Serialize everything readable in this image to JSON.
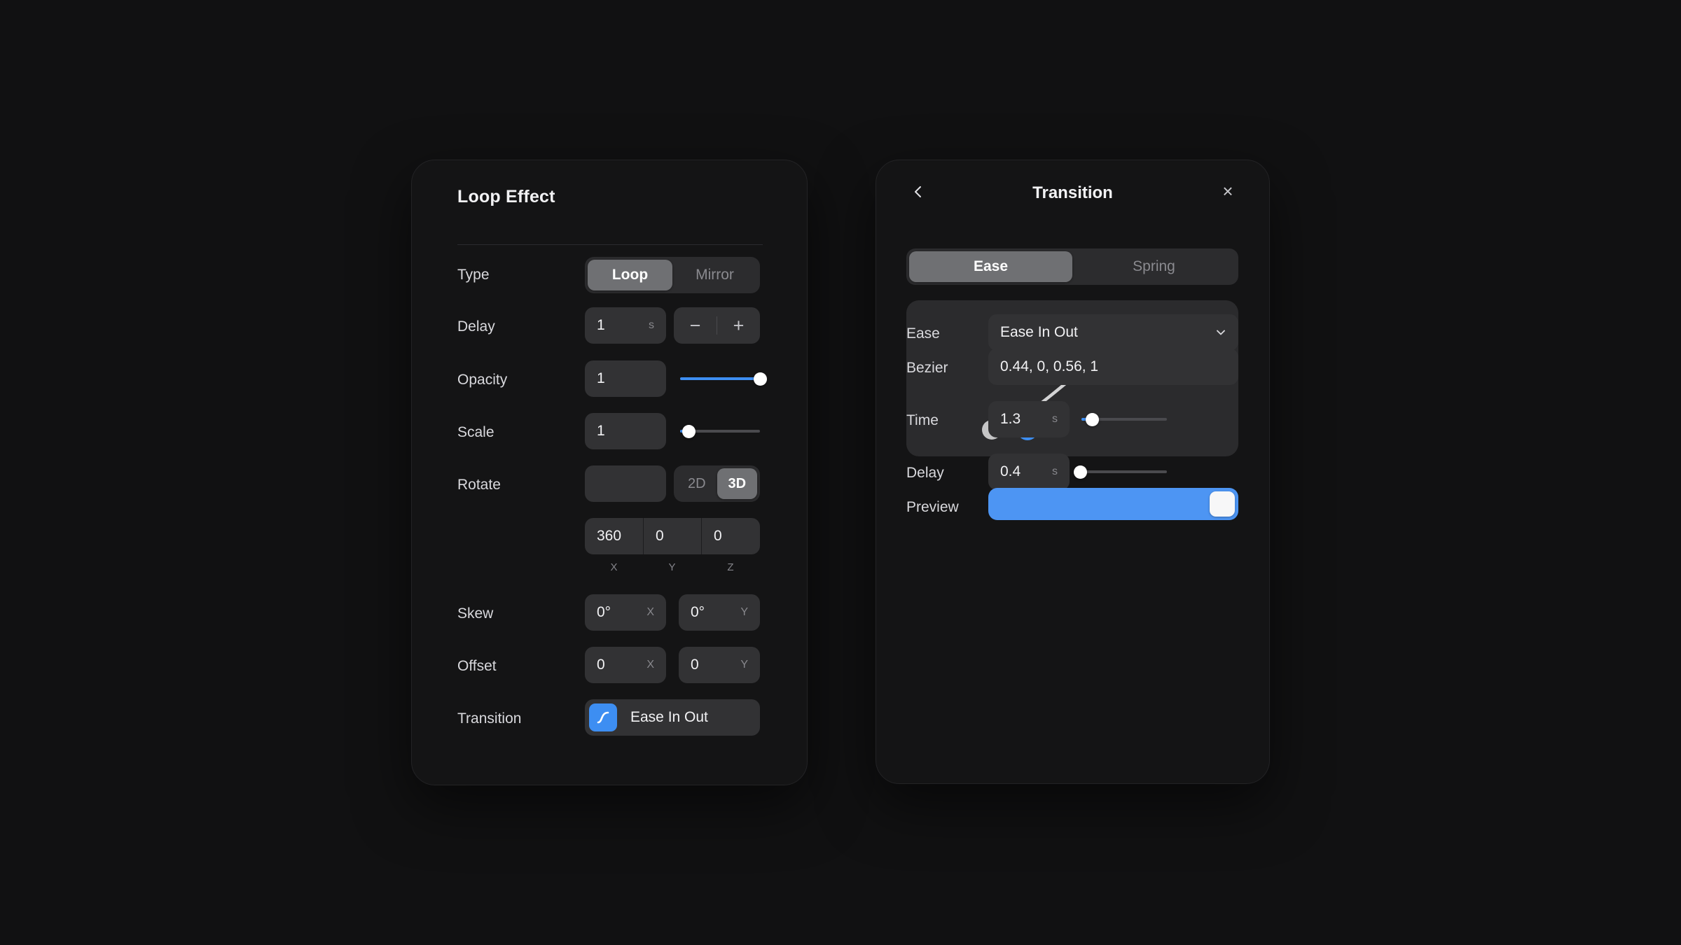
{
  "theme": {
    "background": "#111112",
    "panel_bg": "#141415",
    "field_bg": "#323234",
    "accent": "#3d8ef2",
    "toggle_on": "#4d95f3",
    "segment_active": "#6f7073",
    "text_primary": "#f2f2f4",
    "text_muted": "#88888d"
  },
  "loop_panel": {
    "title": "Loop Effect",
    "close_label": "×",
    "rows": {
      "type": {
        "label": "Type",
        "options": [
          "Loop",
          "Mirror"
        ],
        "selected": "Loop"
      },
      "delay": {
        "label": "Delay",
        "value": "1",
        "unit": "s",
        "minus_label": "−",
        "plus_label": "+"
      },
      "opacity": {
        "label": "Opacity",
        "value": "1",
        "slider_percent": 100
      },
      "scale": {
        "label": "Scale",
        "value": "1",
        "slider_percent": 11
      },
      "rotate": {
        "label": "Rotate",
        "value": "",
        "modes": [
          "2D",
          "3D"
        ],
        "selected_mode": "3D",
        "axes": [
          {
            "axis": "X",
            "value": "360"
          },
          {
            "axis": "Y",
            "value": "0"
          },
          {
            "axis": "Z",
            "value": "0"
          }
        ]
      },
      "skew": {
        "label": "Skew",
        "fields": [
          {
            "value": "0°",
            "suffix": "X"
          },
          {
            "value": "0°",
            "suffix": "Y"
          }
        ]
      },
      "offset": {
        "label": "Offset",
        "fields": [
          {
            "value": "0",
            "suffix": "X"
          },
          {
            "value": "0",
            "suffix": "Y"
          }
        ]
      },
      "transition": {
        "label": "Transition",
        "value": "Ease In Out",
        "icon": "ease-curve-icon"
      }
    }
  },
  "transition_panel": {
    "title": "Transition",
    "back_label": "‹",
    "close_label": "×",
    "tabs": {
      "options": [
        "Ease",
        "Spring"
      ],
      "selected": "Ease"
    },
    "bezier_editor": {
      "control_points": [
        0.44,
        0,
        0.56,
        1
      ],
      "start_point": [
        0,
        0
      ],
      "end_point": [
        1,
        1
      ]
    },
    "rows": {
      "ease": {
        "label": "Ease",
        "value": "Ease In Out",
        "caret": "chevron-down-icon"
      },
      "bezier": {
        "label": "Bezier",
        "value": "0.44, 0, 0.56, 1"
      },
      "time": {
        "label": "Time",
        "value": "1.3",
        "unit": "s",
        "slider_percent": 13
      },
      "delay": {
        "label": "Delay",
        "value": "0.4",
        "unit": "s",
        "slider_percent": 4
      },
      "preview": {
        "label": "Preview",
        "state": "on"
      }
    }
  }
}
